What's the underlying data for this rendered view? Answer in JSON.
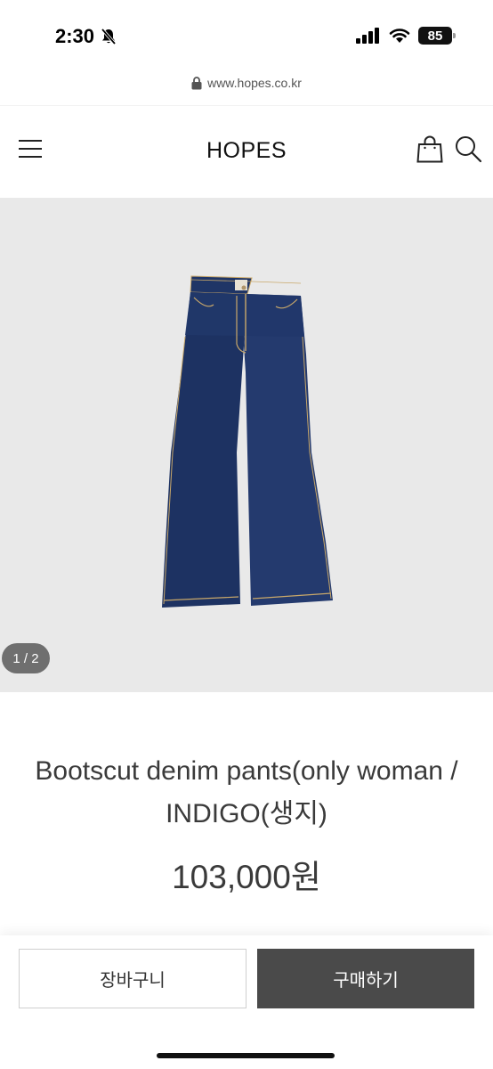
{
  "status_bar": {
    "time": "2:30",
    "battery": "85",
    "icons": [
      "bell-slash-icon",
      "signal-icon",
      "wifi-icon",
      "battery-icon"
    ]
  },
  "browser": {
    "url": "www.hopes.co.kr",
    "icons": [
      "lock-icon"
    ]
  },
  "header": {
    "brand": "HOPES",
    "icons": [
      "hamburger-menu-icon",
      "shopping-bag-icon",
      "search-icon"
    ]
  },
  "gallery": {
    "page_indicator": "1 / 2",
    "current": 1,
    "total": 2,
    "image": "indigo-bootcut-jeans"
  },
  "product": {
    "name": "Bootscut denim pants(only woman / INDIGO(생지)",
    "price": "103,000원"
  },
  "actions": {
    "cart_label": "장바구니",
    "buy_label": "구매하기"
  },
  "colors": {
    "gallery_bg": "#e9e9e9",
    "buy_button_bg": "#4a4a4a",
    "denim": "#1f3566",
    "stitching": "#c9a86a"
  }
}
